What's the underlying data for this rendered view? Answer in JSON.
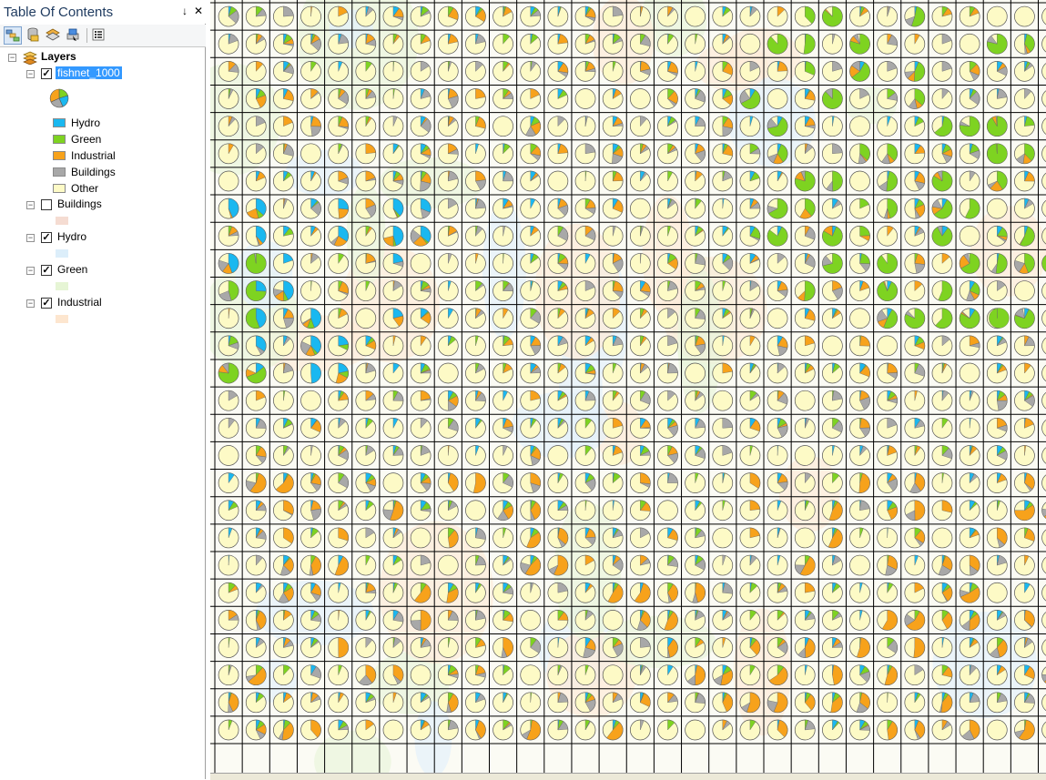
{
  "toc": {
    "title": "Table Of Contents",
    "pin_glyph": "↓",
    "close_glyph": "✕",
    "toolbar": [
      {
        "name": "list-by-drawing-order-icon",
        "active": true
      },
      {
        "name": "list-by-source-icon",
        "active": false
      },
      {
        "name": "list-by-visibility-icon",
        "active": false
      },
      {
        "name": "list-by-selection-icon",
        "active": false
      },
      {
        "name": "options-icon",
        "active": false
      }
    ],
    "root": {
      "label": "Layers",
      "expand_glyph": "−"
    },
    "layers": [
      {
        "label": "fishnet_1000",
        "checked": true,
        "selected": true,
        "check_glyph": "✓",
        "expand_glyph": "−"
      },
      {
        "label": "Buildings",
        "checked": false,
        "selected": false,
        "check_glyph": "",
        "expand_glyph": "−",
        "swatch": "#f5dcd2"
      },
      {
        "label": "Hydro",
        "checked": true,
        "selected": false,
        "check_glyph": "✓",
        "expand_glyph": "−",
        "swatch": "#dceefa"
      },
      {
        "label": "Green",
        "checked": true,
        "selected": false,
        "check_glyph": "✓",
        "expand_glyph": "−",
        "swatch": "#e6f5d5"
      },
      {
        "label": "Industrial",
        "checked": true,
        "selected": false,
        "check_glyph": "✓",
        "expand_glyph": "−",
        "swatch": "#fde6cf"
      }
    ],
    "legend": [
      {
        "label": "Hydro",
        "color": "#1ab8f0"
      },
      {
        "label": "Green",
        "color": "#7ed321"
      },
      {
        "label": "Industrial",
        "color": "#f7a21b"
      },
      {
        "label": "Buildings",
        "color": "#a8a8a8"
      },
      {
        "label": "Other",
        "color": "#fdfac6"
      }
    ]
  },
  "map": {
    "rows": 27,
    "cols": 31,
    "cell_color": "#fdfac6",
    "grid_color": "#000000",
    "slice_colors": {
      "hydro": "#1ab8f0",
      "green": "#7ed321",
      "industrial": "#f7a21b",
      "buildings": "#a8a8a8",
      "other": "#fdfac6"
    },
    "background_tints": [
      "#fdebd9",
      "#e4f1fb",
      "#e9f5dc"
    ]
  }
}
